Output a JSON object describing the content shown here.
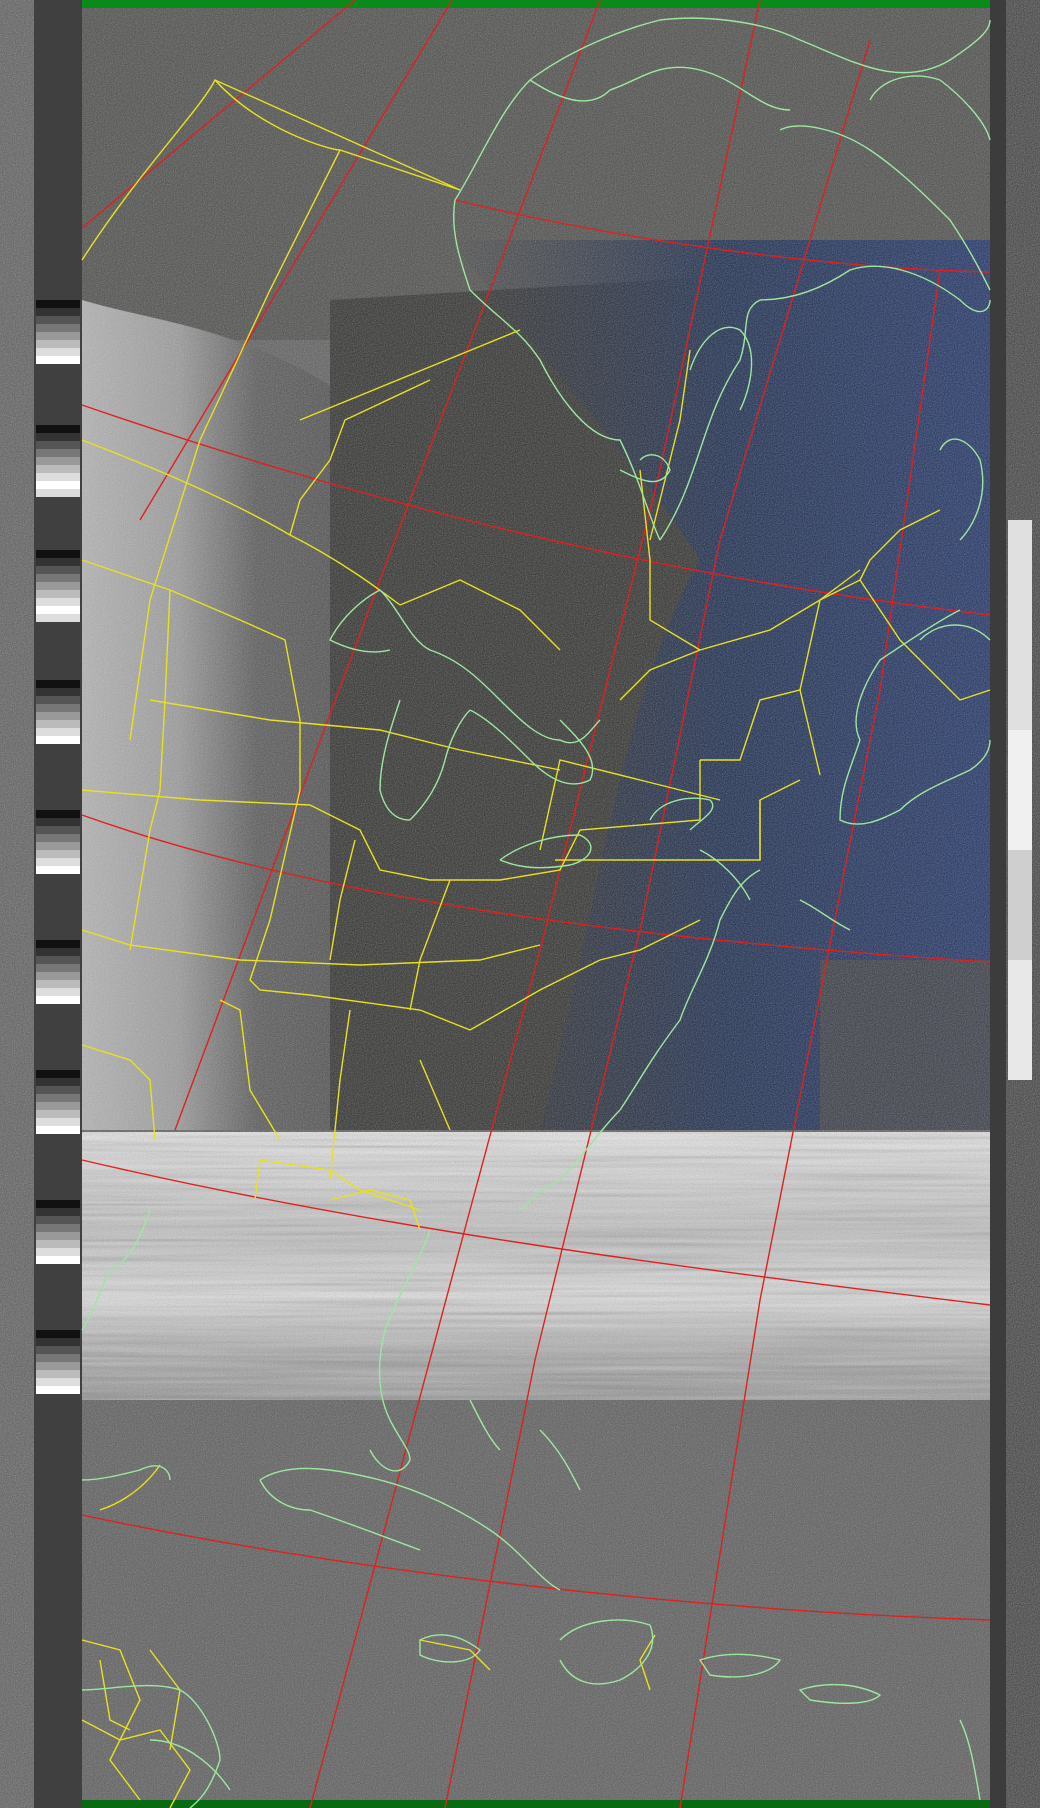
{
  "image": {
    "kind": "apt-weather-satellite-map",
    "visible_text": []
  },
  "colors": {
    "state_borders": "#e8e020",
    "coastlines": "#9ee6a0",
    "graticule": "#e02020",
    "sync_bar_top": "#0a8a1a",
    "ocean_tint": "#1a2a55",
    "cloud_gray": "#c8c8c8",
    "static_noise": "#7a7a7a",
    "white_band": "#e8e8e8"
  },
  "layers": {
    "graticule": true,
    "state_borders": true,
    "coastlines": true,
    "telemetry_wedges": true
  }
}
